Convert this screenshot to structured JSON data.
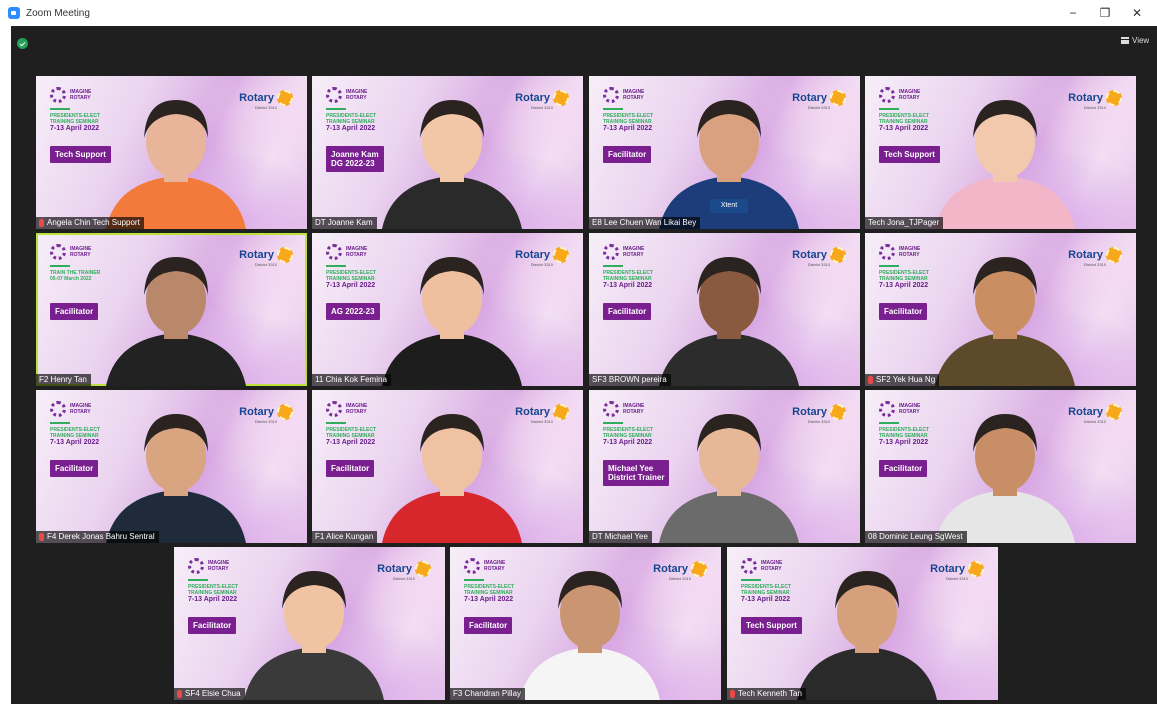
{
  "window": {
    "title": "Zoom Meeting",
    "minimize_label": "−",
    "restore_label": "❐",
    "close_label": "✕"
  },
  "toolbar": {
    "view_label": "View"
  },
  "colors": {
    "accent": "#7a1f8f",
    "active_border": "#bde13c",
    "rotary_blue": "#17458f",
    "rotary_gold": "#f7a81b",
    "green": "#2fae5b"
  },
  "branding": {
    "imagine_line1": "IMAGINE",
    "imagine_line2": "ROTARY",
    "rotary": "Rotary",
    "rotary_sub": "District 3310",
    "seminar_line1": "PRESIDENTS-ELECT",
    "seminar_line2": "TRAINING SEMINAR",
    "seminar_dates": "7-13 April 2022",
    "trainer_line1": "TRAIN THE TRAINER",
    "trainer_dates": "05-07 March 2022"
  },
  "participants": [
    {
      "name": "Angela Chin Tech Support",
      "badge": "Tech Support",
      "muted": true,
      "seminar": "pets"
    },
    {
      "name": "DT Joanne Kam",
      "badge": "Joanne Kam\nDG 2022-23",
      "muted": false,
      "seminar": "pets"
    },
    {
      "name": "E8 Lee Chuen Wan Likai Bey",
      "badge": "Facilitator",
      "muted": false,
      "seminar": "pets",
      "speaking": "Xtent"
    },
    {
      "name": "Tech Jona_TJPager",
      "badge": "Tech Support",
      "muted": false,
      "seminar": "pets"
    },
    {
      "name": "F2 Henry Tan",
      "badge": "Facilitator",
      "muted": false,
      "seminar": "trainer",
      "active": true
    },
    {
      "name": "11 Chia Kok Femina",
      "badge": "AG 2022-23",
      "muted": false,
      "seminar": "pets"
    },
    {
      "name": "SF3 BROWN pereira",
      "badge": "Facilitator",
      "muted": false,
      "seminar": "pets"
    },
    {
      "name": "SF2 Yek Hua Ng",
      "badge": "Facilitator",
      "muted": true,
      "seminar": "pets"
    },
    {
      "name": "F4 Derek Jonas Bahru Sentral",
      "badge": "Facilitator",
      "muted": true,
      "seminar": "pets"
    },
    {
      "name": "F1 Alice Kungan",
      "badge": "Facilitator",
      "muted": false,
      "seminar": "pets"
    },
    {
      "name": "DT Michael Yee",
      "badge": "Michael Yee\nDistrict Trainer",
      "muted": false,
      "seminar": "pets"
    },
    {
      "name": "08 Dominic Leung SgWest",
      "badge": "Facilitator",
      "muted": false,
      "seminar": "pets"
    },
    {
      "name": "SF4 Elsie Chua",
      "badge": "Facilitator",
      "muted": true,
      "seminar": "pets"
    },
    {
      "name": "F3 Chandran Pillay",
      "badge": "Facilitator",
      "muted": false,
      "seminar": "pets"
    },
    {
      "name": "Tech Kenneth Tan",
      "badge": "Tech Support",
      "muted": true,
      "seminar": "pets"
    }
  ]
}
